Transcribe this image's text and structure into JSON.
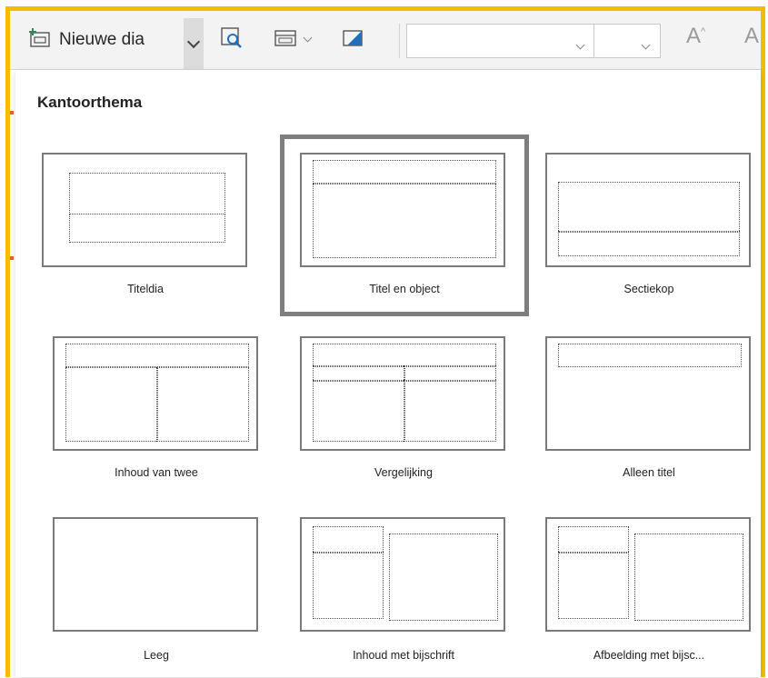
{
  "toolbar": {
    "new_slide_label": "Nieuwe dia",
    "font_size_grow": "A",
    "font_size_shrink": "A"
  },
  "panel": {
    "heading": "Kantoorthema",
    "selected_layout": "Titel en object",
    "layouts": [
      {
        "name": "Titeldia"
      },
      {
        "name": "Titel en object"
      },
      {
        "name": "Sectiekop"
      },
      {
        "name": "Inhoud van twee"
      },
      {
        "name": "Vergelijking"
      },
      {
        "name": "Alleen titel"
      },
      {
        "name": "Leeg"
      },
      {
        "name": "Inhoud met bijschrift"
      },
      {
        "name": "Afbeelding met bijsc..."
      }
    ]
  },
  "colors": {
    "frame_border": "#f5bd02",
    "selection": "#7f7f7f",
    "accent_mark": "#e8612c"
  }
}
